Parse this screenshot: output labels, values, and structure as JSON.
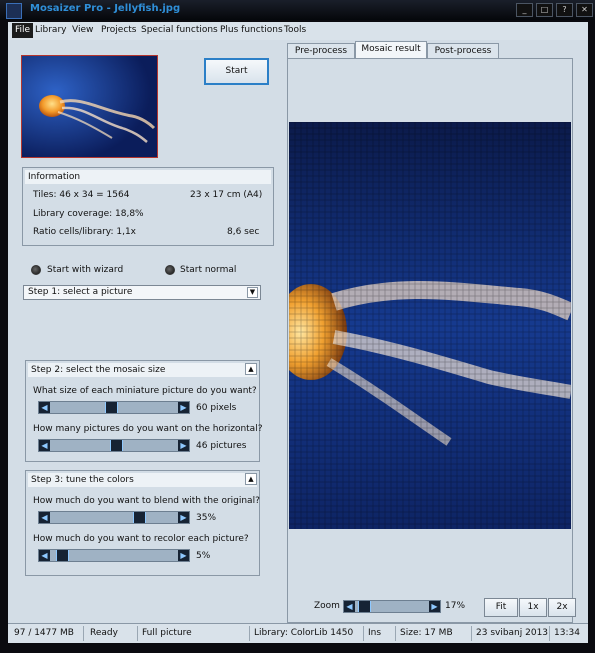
{
  "window": {
    "title": "Mosaizer Pro - Jellyfish.jpg"
  },
  "menu": [
    "File",
    "Library",
    "View",
    "Projects",
    "Special functions",
    "Plus functions",
    "Tools"
  ],
  "start_button": "Start",
  "information": {
    "title": "Information",
    "tiles": "Tiles: 46 x 34 = 1564",
    "size": "23 x 17 cm  (A4)",
    "coverage": "Library coverage: 18,8%",
    "ratio": "Ratio cells/library: 1,1x",
    "time": "8,6 sec"
  },
  "mode": {
    "wizard": "Start with wizard",
    "normal": "Start normal"
  },
  "step1": {
    "selected": "Step 1: select a picture"
  },
  "step2": {
    "title": "Step 2: select the mosaic size",
    "q1": "What size of each miniature picture do you want?",
    "v1": "60 pixels",
    "q2": "How many pictures do you want on the horizontal?",
    "v2": "46 pictures",
    "level1": 0.48,
    "level2": 0.52
  },
  "step3": {
    "title": "Step 3: tune the colors",
    "q1": "How much do you want to blend with the original?",
    "v1": "35%",
    "q2": "How much do you want to recolor each picture?",
    "v2": "5%",
    "level1": 0.72,
    "level2": 0.05
  },
  "tabs": [
    "Pre-process",
    "Mosaic result",
    "Post-process"
  ],
  "zoom": {
    "label": "Zoom",
    "value": "17%",
    "level": 0.05
  },
  "zoom_buttons": [
    "Fit",
    "1x",
    "2x"
  ],
  "status": {
    "memory": "97 / 1477 MB",
    "state": "Ready",
    "view": "Full picture",
    "library": "Library: ColorLib 1450",
    "ins": "Ins",
    "size": "Size:  17 MB",
    "date": "23 svibanj 2013",
    "time": "13:34"
  },
  "colors": {
    "accent": "#2b7fc7",
    "mosaic_bg": "#0e2464",
    "jelly": "#f0a030"
  }
}
